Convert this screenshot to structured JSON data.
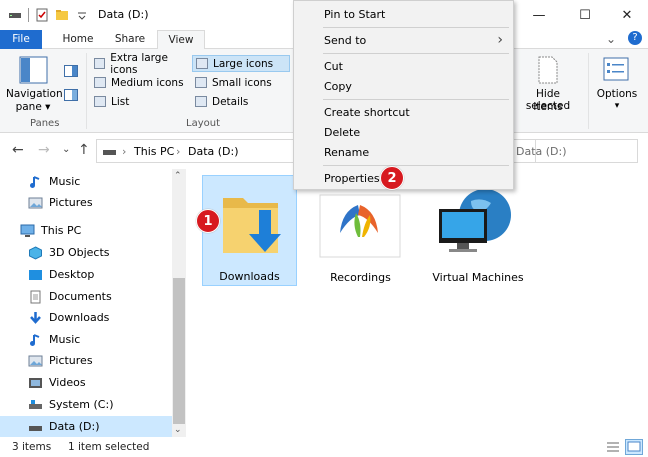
{
  "window": {
    "title": "Data (D:)",
    "minimize_glyph": "—",
    "maximize_glyph": "☐",
    "close_glyph": "✕"
  },
  "tabs": [
    {
      "label": "File"
    },
    {
      "label": "Home"
    },
    {
      "label": "Share"
    },
    {
      "label": "View"
    }
  ],
  "ribbon": {
    "panes_group": {
      "navigation_pane": "Navigation",
      "navigation_pane_2": "pane ▾",
      "label": "Panes"
    },
    "layout_group": {
      "label": "Layout",
      "items": [
        {
          "label": "Extra large icons"
        },
        {
          "label": "Large icons"
        },
        {
          "label": "Medium icons"
        },
        {
          "label": "Small icons"
        },
        {
          "label": "List"
        },
        {
          "label": "Details"
        }
      ]
    },
    "hide_selected_items": "Hide selected",
    "hide_selected_items_2": "items",
    "options": "Options",
    "options_arrow": "▾"
  },
  "address": {
    "crumbs": [
      "This PC",
      "Data (D:)"
    ],
    "separator": "›",
    "search_placeholder": "Data (D:)"
  },
  "sidebar": {
    "items": [
      {
        "label": "Music"
      },
      {
        "label": "Pictures"
      },
      {
        "label": "This PC"
      },
      {
        "label": "3D Objects"
      },
      {
        "label": "Desktop"
      },
      {
        "label": "Documents"
      },
      {
        "label": "Downloads"
      },
      {
        "label": "Music"
      },
      {
        "label": "Pictures"
      },
      {
        "label": "Videos"
      },
      {
        "label": "System (C:)"
      },
      {
        "label": "Data (D:)"
      }
    ]
  },
  "content": {
    "items": [
      {
        "label": "Downloads"
      },
      {
        "label": "Recordings"
      },
      {
        "label": "Virtual Machines"
      }
    ]
  },
  "status": {
    "count": "3 items",
    "selected": "1 item selected"
  },
  "context_menu": {
    "items": [
      {
        "label": "Pin to Start"
      },
      {
        "label": "Send to"
      },
      {
        "label": "Cut"
      },
      {
        "label": "Copy"
      },
      {
        "label": "Create shortcut"
      },
      {
        "label": "Delete"
      },
      {
        "label": "Rename"
      },
      {
        "label": "Properties"
      }
    ],
    "submenu_arrow": "›"
  },
  "badges": [
    "1",
    "2"
  ],
  "colors": {
    "file_tab": "#1f6ccf",
    "selection": "#cce8ff",
    "badge": "#d7191f"
  }
}
